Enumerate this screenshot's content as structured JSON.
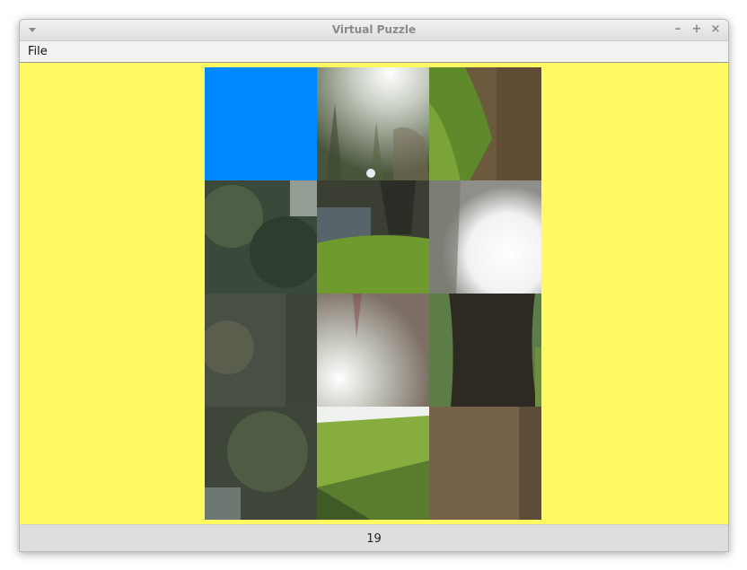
{
  "window": {
    "title": "Virtual Puzzle",
    "controls": {
      "minimize": "–",
      "maximize": "+",
      "close": "×"
    }
  },
  "menubar": {
    "file_label": "File"
  },
  "puzzle": {
    "background_color": "#fffa62",
    "blank_color": "#0088ff",
    "columns": 3,
    "rows": 4,
    "tiles": [
      {
        "kind": "blank"
      },
      {
        "kind": "image",
        "scene": "sunlit-trees"
      },
      {
        "kind": "image",
        "scene": "grass-and-leaves"
      },
      {
        "kind": "image",
        "scene": "dark-tree-foliage"
      },
      {
        "kind": "image",
        "scene": "pond-and-lawn"
      },
      {
        "kind": "image",
        "scene": "bright-sun-glare"
      },
      {
        "kind": "image",
        "scene": "dim-foliage"
      },
      {
        "kind": "image",
        "scene": "sun-flare-branches"
      },
      {
        "kind": "image",
        "scene": "tree-trunk"
      },
      {
        "kind": "image",
        "scene": "trees-over-water"
      },
      {
        "kind": "image",
        "scene": "sunny-slope"
      },
      {
        "kind": "image",
        "scene": "leaf-litter"
      }
    ]
  },
  "status": {
    "move_count": "19"
  }
}
